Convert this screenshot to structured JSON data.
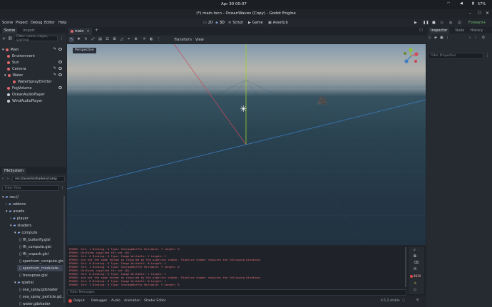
{
  "system_bar": {
    "clock": "Apr 30  00:07",
    "battery": "57%"
  },
  "window": {
    "title": "(*) main.tscn - OceanWaves (Copy) - Godot Engine"
  },
  "menu": {
    "items": [
      "Scene",
      "Project",
      "Debug",
      "Editor",
      "Help"
    ]
  },
  "workspaces": {
    "items": [
      "2D",
      "3D",
      "Script",
      "Game",
      "AssetLib"
    ],
    "active": "3D"
  },
  "renderer": "Forward+",
  "scene_dock": {
    "tabs": [
      "Scene",
      "Import"
    ],
    "filter_placeholder": "Filter: name, t:type, g:group",
    "nodes": [
      {
        "label": "Main",
        "color": "#e0696b"
      },
      {
        "label": "Environment",
        "color": "#e0696b"
      },
      {
        "label": "Sun",
        "color": "#e0696b"
      },
      {
        "label": "Camera",
        "color": "#e0696b"
      },
      {
        "label": "Water",
        "color": "#e0696b"
      },
      {
        "label": "WaterSprayEmitter",
        "color": "#e0696b"
      },
      {
        "label": "FogVolume",
        "color": "#e0696b"
      },
      {
        "label": "OceanAudioPlayer",
        "color": "#c9cdd3"
      },
      {
        "label": "WindAudioPlayer",
        "color": "#c9cdd3"
      }
    ]
  },
  "filesystem": {
    "title": "FileSystem",
    "path": "res://assets/shaders/comp",
    "filter_placeholder": "Filter Files",
    "entries": [
      {
        "label": "res://"
      },
      {
        "label": "addons"
      },
      {
        "label": "assets"
      },
      {
        "label": "player"
      },
      {
        "label": "shaders"
      },
      {
        "label": "compute"
      },
      {
        "label": "fft_butterfly.glsl"
      },
      {
        "label": "fft_compute.glsl"
      },
      {
        "label": "fft_unpack.glsl"
      },
      {
        "label": "spectrum_compute.glsl"
      },
      {
        "label": "spectrum_modulate..."
      },
      {
        "label": "transpose.glsl"
      },
      {
        "label": "spatial"
      },
      {
        "label": "sea_spray.gdshader"
      },
      {
        "label": "sea_spray_particle.gd..."
      },
      {
        "label": "water.gdshader"
      }
    ]
  },
  "editor_tabs": {
    "scene_tab": "main"
  },
  "viewport": {
    "toolbar": {
      "transform_label": "Transform",
      "view_label": "View"
    },
    "perspective_label": "Perspective"
  },
  "output": {
    "lines": [
      "ERROR: Set: 1 Binding: 0 Type: StorageBuffer Writable: Y Length: 0",
      "ERROR: Uniforms supplied for set (0):",
      "ERROR: Set: 0 Binding: 0 Type: Image Writable: Y Length: 1",
      "ERROR: are not the same format as required by the pipeline shader. Pipeline shader requires the following bindings:",
      "ERROR: Set: 0 Binding: 0 Type: Image Writable: N Length: 1",
      "ERROR: Set: 1 Binding: 0 Type: StorageBuffer Writable: Y Length: 0",
      "ERROR: Uniforms supplied for set (0):",
      "ERROR: Set: 0 Binding: 0 Type: Image Writable: Y Length: 1",
      "ERROR: are not the same format as required by the pipeline shader. Pipeline shader requires the following bindings:",
      "ERROR: Set: 0 Binding: 0 Type: Image Writable: N Length: 1",
      "ERROR: Set: 1 Binding: 0 Type: StorageBuffer Writable: Y Length: 0"
    ],
    "filter_placeholder": "Filter Messages",
    "error_count": "8830"
  },
  "bottom_tabs": [
    "Output",
    "Debugger",
    "Audio",
    "Animation",
    "Shader Editor"
  ],
  "version": "4.5.2.stable",
  "inspector": {
    "tabs": [
      "Inspector",
      "Node",
      "History"
    ],
    "filter_placeholder": "Filter Properties"
  }
}
